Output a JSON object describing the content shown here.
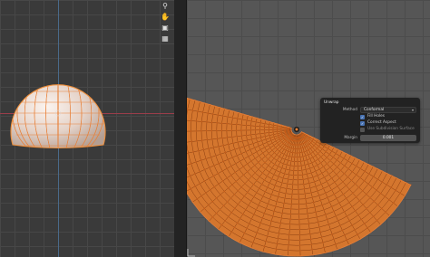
{
  "viewport_tools": [
    {
      "icon": "zoom-icon",
      "glyph": "⚲"
    },
    {
      "icon": "hand-icon",
      "glyph": "✋"
    },
    {
      "icon": "camera-icon",
      "glyph": "▣"
    },
    {
      "icon": "grid-icon",
      "glyph": "▦"
    }
  ],
  "unwrap_panel": {
    "title": "Unwrap",
    "method_label": "Method",
    "method_value": "Conformal",
    "fill_holes_label": "Fill Holes",
    "fill_holes_checked": true,
    "correct_aspect_label": "Correct Aspect",
    "correct_aspect_checked": true,
    "use_subsurf_label": "Use Subdivision Surface",
    "use_subsurf_checked": false,
    "margin_label": "Margin",
    "margin_value": "0.001"
  },
  "colors": {
    "accent_orange": "#e8813a",
    "mesh_white": "#f2e4dc",
    "checkbox_blue": "#4772b3"
  }
}
